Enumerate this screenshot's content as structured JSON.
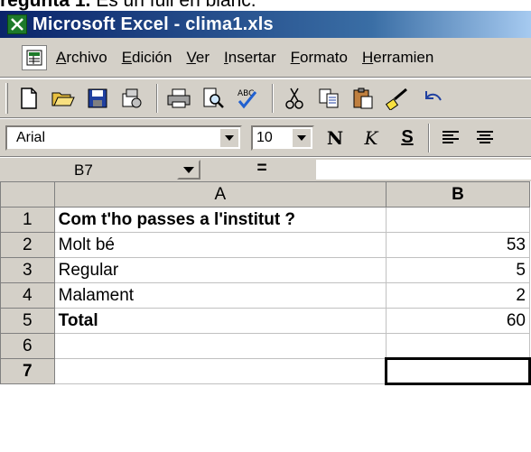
{
  "caption": {
    "bold": "regunta 1.",
    "rest": " Es un full en blanc."
  },
  "window": {
    "title": "Microsoft Excel - clima1.xls"
  },
  "menu": {
    "items": [
      {
        "underline": "A",
        "rest": "rchivo"
      },
      {
        "underline": "E",
        "rest": "dición"
      },
      {
        "underline": "V",
        "rest": "er"
      },
      {
        "underline": "I",
        "rest": "nsertar"
      },
      {
        "underline": "F",
        "rest": "ormato"
      },
      {
        "underline": "H",
        "rest": "erramien"
      }
    ]
  },
  "toolbar_formatting": {
    "font": "Arial",
    "size": "10",
    "bold_label": "N",
    "italic_label": "K",
    "underline_label": "S"
  },
  "formula_bar": {
    "name_box": "B7",
    "equals": "="
  },
  "sheet": {
    "columns": [
      "A",
      "B"
    ],
    "rows": [
      {
        "num": "1",
        "a": "Com t'ho passes a l'institut ?",
        "b": ""
      },
      {
        "num": "2",
        "a": "Molt bé",
        "b": "53"
      },
      {
        "num": "3",
        "a": "Regular",
        "b": "5"
      },
      {
        "num": "4",
        "a": "Malament",
        "b": "2"
      },
      {
        "num": "5",
        "a": "Total",
        "b": "60"
      },
      {
        "num": "6",
        "a": "",
        "b": ""
      },
      {
        "num": "7",
        "a": "",
        "b": ""
      }
    ]
  },
  "colors": {
    "title_bar": "#0a246a",
    "chrome": "#d4d0c8",
    "excel_icon": "#1d7a2a"
  }
}
